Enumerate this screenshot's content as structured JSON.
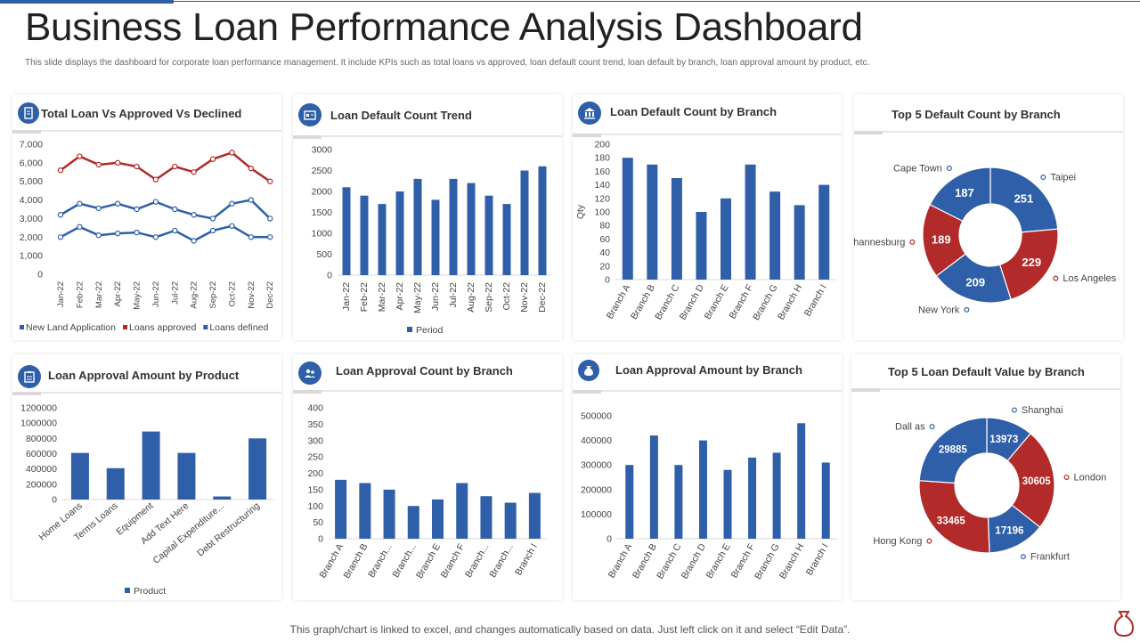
{
  "header": {
    "title": "Business Loan Performance Analysis Dashboard",
    "subtitle": "This slide displays the dashboard for corporate loan performance management.  It include KPIs such as total loans vs approved, loan default count trend, loan  default by branch, loan approval amount by product, etc."
  },
  "footer": {
    "note": "This graph/chart is linked to excel,  and changes automatically based on data. Just left click on it and select “Edit Data”."
  },
  "colors": {
    "blue": "#2e5fa8",
    "red": "#b22a2a"
  },
  "cards": {
    "c1": {
      "title": "Total Loan Vs Approved Vs Declined",
      "icon": "document-icon"
    },
    "c2": {
      "title": "Loan Default Count Trend",
      "icon": "id-card-icon"
    },
    "c3": {
      "title": "Loan Default Count by Branch",
      "icon": "bank-icon"
    },
    "c4": {
      "title": "Top 5 Default Count by Branch"
    },
    "c5": {
      "title": "Loan Approval Amount by Product",
      "icon": "clipboard-icon"
    },
    "c6": {
      "title": "Loan Approval Count by Branch",
      "icon": "people-icon"
    },
    "c7": {
      "title": "Loan Approval Amount by Branch",
      "icon": "money-bag-icon"
    },
    "c8": {
      "title": "Top 5 Loan Default Value by Branch"
    }
  },
  "chart_data": [
    {
      "id": "c1",
      "type": "line",
      "categories": [
        "Jan-22",
        "Feb-22",
        "Mar-22",
        "Apr-22",
        "May-22",
        "Jun-22",
        "Jul-22",
        "Aug-22",
        "Sep-22",
        "Oct-22",
        "Nov-22",
        "Dec-22"
      ],
      "ylim": [
        0,
        7000
      ],
      "yticks": [
        "0",
        "1,000",
        "2,000",
        "3,000",
        "4,000",
        "5,000",
        "6,000",
        "7,000"
      ],
      "series": [
        {
          "name": "New Land Application",
          "color": "#2e5fa8",
          "values": [
            2000,
            2550,
            2100,
            2200,
            2250,
            2000,
            2350,
            1800,
            2350,
            2600,
            2000,
            2000
          ]
        },
        {
          "name": "Loans approved",
          "color": "#b22a2a",
          "values": [
            5600,
            6350,
            5900,
            6000,
            5800,
            5100,
            5800,
            5500,
            6200,
            6550,
            5700,
            5000
          ]
        },
        {
          "name": "Loans defined",
          "color": "#2e5fa8",
          "values": [
            3200,
            3800,
            3550,
            3800,
            3500,
            3900,
            3500,
            3200,
            3000,
            3800,
            4000,
            3000
          ]
        }
      ]
    },
    {
      "id": "c2",
      "type": "bar",
      "categories": [
        "Jan-22",
        "Feb-22",
        "Mar-22",
        "Apr-22",
        "May-22",
        "Jun-22",
        "Jul-22",
        "Aug-22",
        "Sep-22",
        "Oct-22",
        "Nov-22",
        "Dec-22"
      ],
      "values": [
        2100,
        1900,
        1700,
        2000,
        2300,
        1800,
        2300,
        2200,
        1900,
        1700,
        2500,
        2600
      ],
      "ylim": [
        0,
        3000
      ],
      "yticks": [
        "0",
        "500",
        "1000",
        "1500",
        "2000",
        "2500",
        "3000"
      ],
      "legend": "Period"
    },
    {
      "id": "c3",
      "type": "bar",
      "categories": [
        "Branch A",
        "Branch B",
        "Branch C",
        "Branch D",
        "Branch E",
        "Branch F",
        "Branch G",
        "Branch H",
        "Branch I"
      ],
      "values": [
        180,
        170,
        150,
        100,
        120,
        170,
        130,
        110,
        140
      ],
      "ylim": [
        0,
        200
      ],
      "yticks": [
        "0",
        "20",
        "40",
        "60",
        "80",
        "100",
        "120",
        "140",
        "160",
        "180",
        "200"
      ],
      "ylabel": "Qty"
    },
    {
      "id": "c4",
      "type": "pie",
      "labels": [
        "Taipei",
        "Los Angeles",
        "New York",
        "Johannesburg",
        "Cape Town"
      ],
      "values": [
        251,
        229,
        209,
        189,
        187
      ],
      "colors": [
        "#2e5fa8",
        "#b22a2a",
        "#2e5fa8",
        "#b22a2a",
        "#2e5fa8"
      ]
    },
    {
      "id": "c5",
      "type": "bar",
      "categories": [
        "Home Loans",
        "Terms Loans",
        "Equipment",
        "Add Text Here",
        "Capital Expenditure...",
        "Debt Restructuring"
      ],
      "values": [
        610000,
        410000,
        890000,
        610000,
        40000,
        800000
      ],
      "ylim": [
        0,
        1200000
      ],
      "yticks": [
        "0",
        "200000",
        "400000",
        "600000",
        "800000",
        "1000000",
        "1200000"
      ],
      "legend": "Product"
    },
    {
      "id": "c6",
      "type": "bar",
      "categories": [
        "Branch A",
        "Branch B",
        "Branch...",
        "Branch...",
        "Branch E",
        "Branch F",
        "Branch...",
        "Branch...",
        "Branch I"
      ],
      "values": [
        180,
        170,
        150,
        100,
        120,
        170,
        130,
        110,
        140
      ],
      "ylim": [
        0,
        400
      ],
      "yticks": [
        "0",
        "50",
        "100",
        "150",
        "200",
        "250",
        "300",
        "350",
        "400"
      ]
    },
    {
      "id": "c7",
      "type": "bar",
      "categories": [
        "Branch A",
        "Branch B",
        "Branch C",
        "Branch D",
        "Branch E",
        "Branch F",
        "Branch G",
        "Branch H",
        "Branch I"
      ],
      "values": [
        300000,
        420000,
        300000,
        400000,
        280000,
        330000,
        350000,
        470000,
        310000
      ],
      "ylim": [
        0,
        500000
      ],
      "yticks": [
        "0",
        "100000",
        "200000",
        "300000",
        "400000",
        "500000"
      ]
    },
    {
      "id": "c8",
      "type": "pie",
      "labels": [
        "Shanghai",
        "London",
        "Frankfurt",
        "Hong Kong",
        "Dall as"
      ],
      "values": [
        13973,
        30605,
        17196,
        33465,
        29885
      ],
      "colors": [
        "#2e5fa8",
        "#b22a2a",
        "#2e5fa8",
        "#b22a2a",
        "#2e5fa8"
      ]
    }
  ]
}
